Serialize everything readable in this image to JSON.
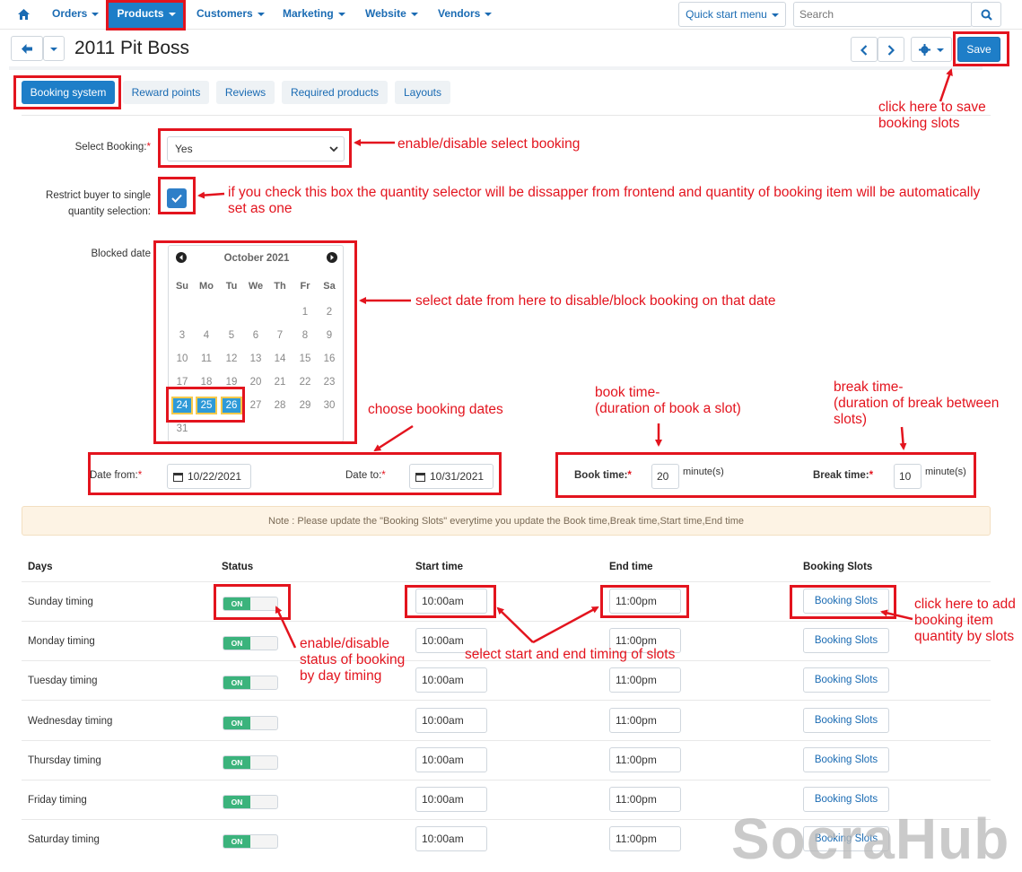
{
  "nav": {
    "items": [
      {
        "label": "Orders"
      },
      {
        "label": "Products"
      },
      {
        "label": "Customers"
      },
      {
        "label": "Marketing"
      },
      {
        "label": "Website"
      },
      {
        "label": "Vendors"
      }
    ],
    "quick_start": "Quick start menu",
    "search_placeholder": "Search"
  },
  "header": {
    "title": "2011 Pit Boss",
    "save_label": "Save"
  },
  "tabs": [
    {
      "label": "Booking system"
    },
    {
      "label": "Reward points"
    },
    {
      "label": "Reviews"
    },
    {
      "label": "Required products"
    },
    {
      "label": "Layouts"
    }
  ],
  "form": {
    "select_booking_label": "Select Booking:",
    "select_booking_value": "Yes",
    "restrict_label_1": "Restrict buyer to single",
    "restrict_label_2": "quantity selection:",
    "blocked_date_label": "Blocked date",
    "date_from_label": "Date from:",
    "date_from_value": "10/22/2021",
    "date_to_label": "Date to:",
    "date_to_value": "10/31/2021",
    "book_time_label": "Book time:",
    "book_time_value": "20",
    "break_time_label": "Break time:",
    "break_time_value": "10",
    "minutes_unit": "minute(s)",
    "required_mark": "*"
  },
  "calendar": {
    "month_label": "October 2021",
    "weekdays": [
      "Su",
      "Mo",
      "Tu",
      "We",
      "Th",
      "Fr",
      "Sa"
    ],
    "first_weekday_index": 5,
    "days_in_month": 31,
    "selected_days": [
      24,
      25,
      26
    ]
  },
  "note": "Note : Please update the \"Booking Slots\" everytime you update the Book time,Break time,Start time,End time",
  "table": {
    "headers": [
      "Days",
      "Status",
      "Start time",
      "End time",
      "Booking Slots"
    ],
    "rows": [
      {
        "day": "Sunday timing",
        "status": "ON",
        "start": "10:00am",
        "end": "11:00pm",
        "slots": "Booking Slots"
      },
      {
        "day": "Monday timing",
        "status": "ON",
        "start": "10:00am",
        "end": "11:00pm",
        "slots": "Booking Slots"
      },
      {
        "day": "Tuesday timing",
        "status": "ON",
        "start": "10:00am",
        "end": "11:00pm",
        "slots": "Booking Slots"
      },
      {
        "day": "Wednesday timing",
        "status": "ON",
        "start": "10:00am",
        "end": "11:00pm",
        "slots": "Booking Slots"
      },
      {
        "day": "Thursday timing",
        "status": "ON",
        "start": "10:00am",
        "end": "11:00pm",
        "slots": "Booking Slots"
      },
      {
        "day": "Friday timing",
        "status": "ON",
        "start": "10:00am",
        "end": "11:00pm",
        "slots": "Booking Slots"
      },
      {
        "day": "Saturday timing",
        "status": "ON",
        "start": "10:00am",
        "end": "11:00pm",
        "slots": "Booking Slots"
      }
    ]
  },
  "annotations": {
    "save": [
      "click here to save",
      "booking slots"
    ],
    "select_booking": "enable/disable select booking",
    "restrict": [
      "if you check this box the quantity selector will be dissapper from frontend and quantity of booking item will be automatically",
      "set as one"
    ],
    "calendar": "select date from here to disable/block booking on that date",
    "dates": "choose booking dates",
    "book_time": [
      "book time-",
      "(duration of book a slot)"
    ],
    "break_time": [
      "break time-",
      "(duration of break between",
      "slots)"
    ],
    "status": [
      "enable/disable",
      "status of booking",
      "by day timing"
    ],
    "timing": "select start and end timing of slots",
    "slots": [
      "click here to add",
      "booking item",
      "quantity by slots"
    ]
  },
  "watermark": "SocraHub",
  "colors": {
    "accent": "#1e7ec8",
    "annotation": "#e3141e",
    "toggle_on": "#3bb37c",
    "calendar_selected": "#2e9ad8"
  }
}
